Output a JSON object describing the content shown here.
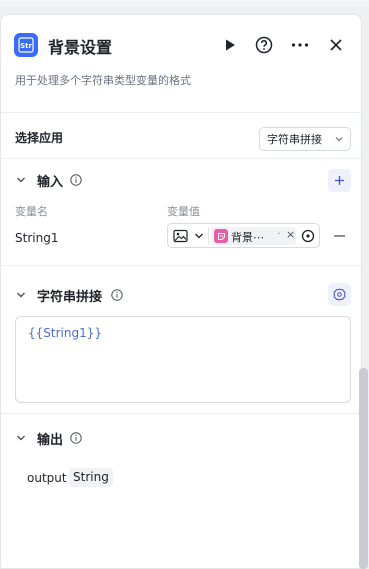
{
  "header": {
    "title": "背景设置",
    "subtitle": "用于处理多个字符串类型变量的格式",
    "app_icon_text": "Str"
  },
  "select_app": {
    "label": "选择应用",
    "value": "字符串拼接"
  },
  "input": {
    "title": "输入",
    "columns": [
      "变量名",
      "变量值"
    ],
    "row": {
      "name": "String1",
      "tag_text": "背景⋯",
      "tag_dot": "·",
      "tag_remove": "×"
    }
  },
  "concat": {
    "title": "字符串拼接",
    "template": "{{String1}}"
  },
  "output": {
    "title": "输出",
    "name": "output",
    "type": "String"
  },
  "colors": {
    "accent": "#3b6cf5",
    "tag_icon": "#e75ea5",
    "template_text": "#4a6cd4"
  }
}
